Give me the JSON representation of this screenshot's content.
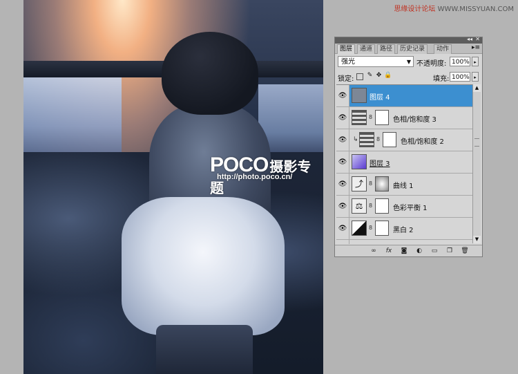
{
  "watermark": {
    "text_red": "思缘设计论坛",
    "text_grey": " WWW.MISSYUAN.COM"
  },
  "canvas": {
    "logo_brand": "POCO",
    "logo_text": "摄影专题",
    "logo_url": "http://photo.poco.cn/"
  },
  "panel": {
    "tabs": [
      "图层",
      "通道",
      "路径",
      "历史记录",
      "动作"
    ],
    "active_tab": "图层",
    "blend_mode": "强光",
    "opacity_label": "不透明度:",
    "opacity_value": "100%",
    "lock_label": "锁定:",
    "fill_label": "填充:",
    "fill_value": "100%",
    "layers": [
      {
        "name": "图层 4",
        "selected": true,
        "type": "pixel"
      },
      {
        "name": "色相/饱和度 3",
        "selected": false,
        "type": "adjust"
      },
      {
        "name": "色相/饱和度 2",
        "selected": false,
        "type": "adjust-clipped"
      },
      {
        "name": "图层 3",
        "selected": false,
        "type": "pixel-purple"
      },
      {
        "name": "曲线 1",
        "selected": false,
        "type": "curves"
      },
      {
        "name": "色彩平衡 1",
        "selected": false,
        "type": "balance"
      },
      {
        "name": "黑白 2",
        "selected": false,
        "type": "bw"
      }
    ],
    "icons": {
      "link": "link-icon",
      "fx": "fx-icon",
      "mask": "add-mask-icon",
      "adjust": "adjustment-icon",
      "group": "folder-icon",
      "new": "new-layer-icon",
      "delete": "trash-icon"
    },
    "fx_label": "fx"
  },
  "colors": {
    "selected": "#3c8fd0",
    "panel_bg": "#d6d6d6",
    "app_bg": "#b4b4b4"
  }
}
